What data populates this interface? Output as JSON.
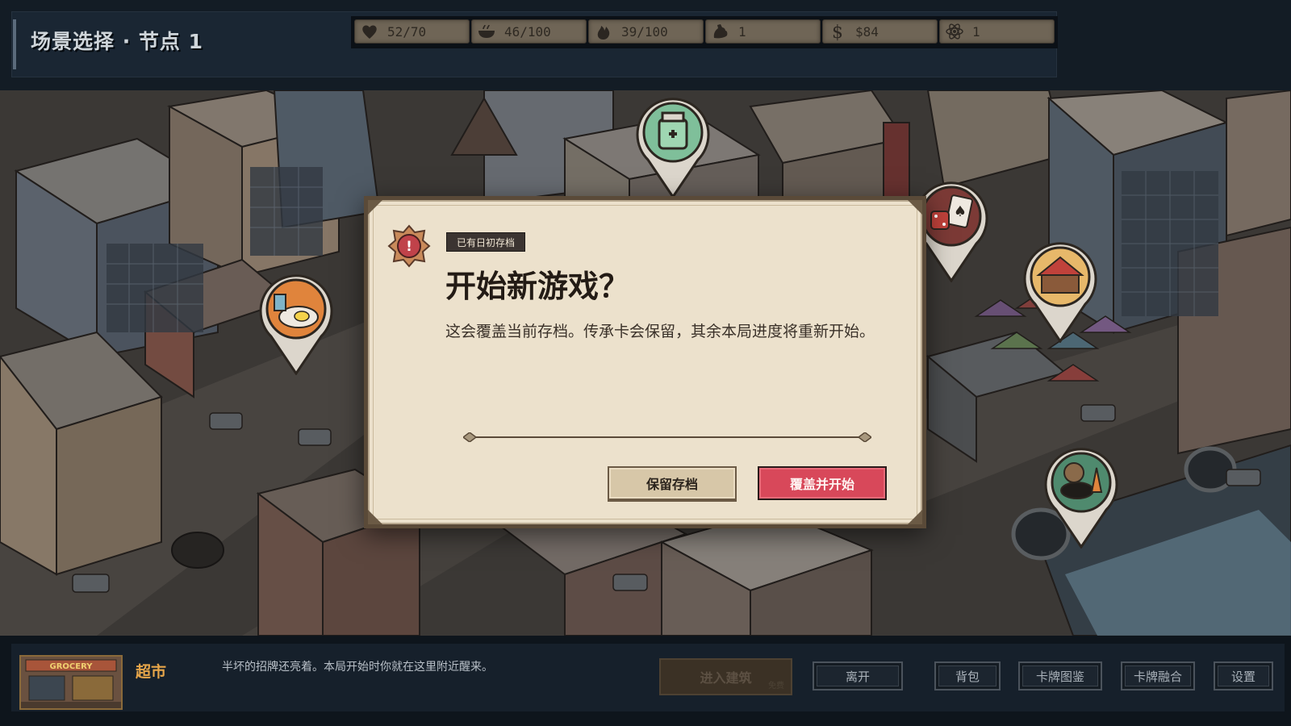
{
  "header": {
    "scene_title": "场景选择 · 节点 1"
  },
  "stats": [
    {
      "icon": "heart-icon",
      "value": "52/70"
    },
    {
      "icon": "food-bowl-icon",
      "value": "46/100"
    },
    {
      "icon": "flame-icon",
      "value": "39/100"
    },
    {
      "icon": "muscle-icon",
      "value": "1"
    },
    {
      "icon": "dollar-icon",
      "value": "$84"
    },
    {
      "icon": "atom-icon",
      "value": "1"
    }
  ],
  "dialog": {
    "badge": "已有日初存档",
    "title": "开始新游戏？",
    "body": "这会覆盖当前存档。传承卡会保留，其余本局进度将重新开始。",
    "keep_label": "保留存档",
    "overwrite_label": "覆盖并开始"
  },
  "location": {
    "name": "超市",
    "description": "半坏的招牌还亮着。本局开始时你就在这里附近醒来。",
    "enter_label": "进入建筑",
    "enter_sub": "免费",
    "thumb_sign": "GROCERY"
  },
  "actions": {
    "leave": "离开",
    "backpack": "背包",
    "card_codex": "卡牌图鉴",
    "card_fusion": "卡牌融合",
    "settings": "设置"
  },
  "colors": {
    "accent_red": "#d8485a",
    "location_orange": "#e7a64a",
    "parchment": "#ece1cc"
  }
}
